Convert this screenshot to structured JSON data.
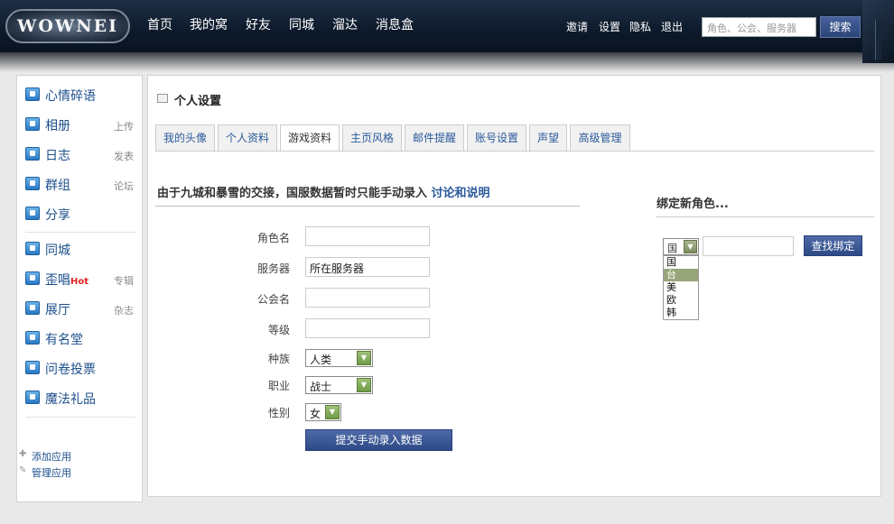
{
  "header": {
    "logo_text": "WOWNEI",
    "nav": [
      "首页",
      "我的窝",
      "好友",
      "同城",
      "溜达",
      "消息盒"
    ],
    "utils": [
      "邀请",
      "设置",
      "隐私",
      "退出"
    ],
    "search_placeholder": "角色、公会、服务器",
    "search_button": "搜索"
  },
  "sidebar": {
    "items": [
      {
        "label": "心情碎语",
        "sub": ""
      },
      {
        "label": "相册",
        "sub": "上传"
      },
      {
        "label": "日志",
        "sub": "发表"
      },
      {
        "label": "群组",
        "sub": "论坛"
      },
      {
        "label": "分享",
        "sub": ""
      },
      {
        "label": "同城",
        "sub": ""
      },
      {
        "label": "歪唱",
        "hot": "Hot",
        "sub": "专辑"
      },
      {
        "label": "展厅",
        "sub": "杂志"
      },
      {
        "label": "有名堂",
        "sub": ""
      },
      {
        "label": "问卷投票",
        "sub": ""
      },
      {
        "label": "魔法礼品",
        "sub": ""
      }
    ],
    "apps": {
      "add": "添加应用",
      "manage": "管理应用"
    }
  },
  "main": {
    "title": "个人设置",
    "tabs": [
      "我的头像",
      "个人资料",
      "游戏资料",
      "主页风格",
      "邮件提醒",
      "账号设置",
      "声望",
      "高级管理"
    ],
    "active_tab": "游戏资料",
    "notice": "由于九城和暴雪的交接，国服数据暂时只能手动录入",
    "notice_link": "讨论和说明",
    "form": {
      "character_label": "角色名",
      "character_value": "",
      "server_label": "服务器",
      "server_value": "所在服务器",
      "guild_label": "公会名",
      "guild_value": "",
      "level_label": "等级",
      "level_value": "",
      "race_label": "种族",
      "race_value": "人类",
      "class_label": "职业",
      "class_value": "战士",
      "gender_label": "性别",
      "gender_value": "女",
      "submit": "提交手动录入数据"
    },
    "bind": {
      "title": "绑定新角色...",
      "region_selected": "国",
      "region_options": [
        "国",
        "台",
        "美",
        "欧",
        "韩"
      ],
      "region_highlight": "台",
      "button": "查找绑定"
    }
  },
  "colors": {
    "link": "#2a5a9b",
    "button": "#2d4a86",
    "select_arrow": "#6f9a46"
  }
}
